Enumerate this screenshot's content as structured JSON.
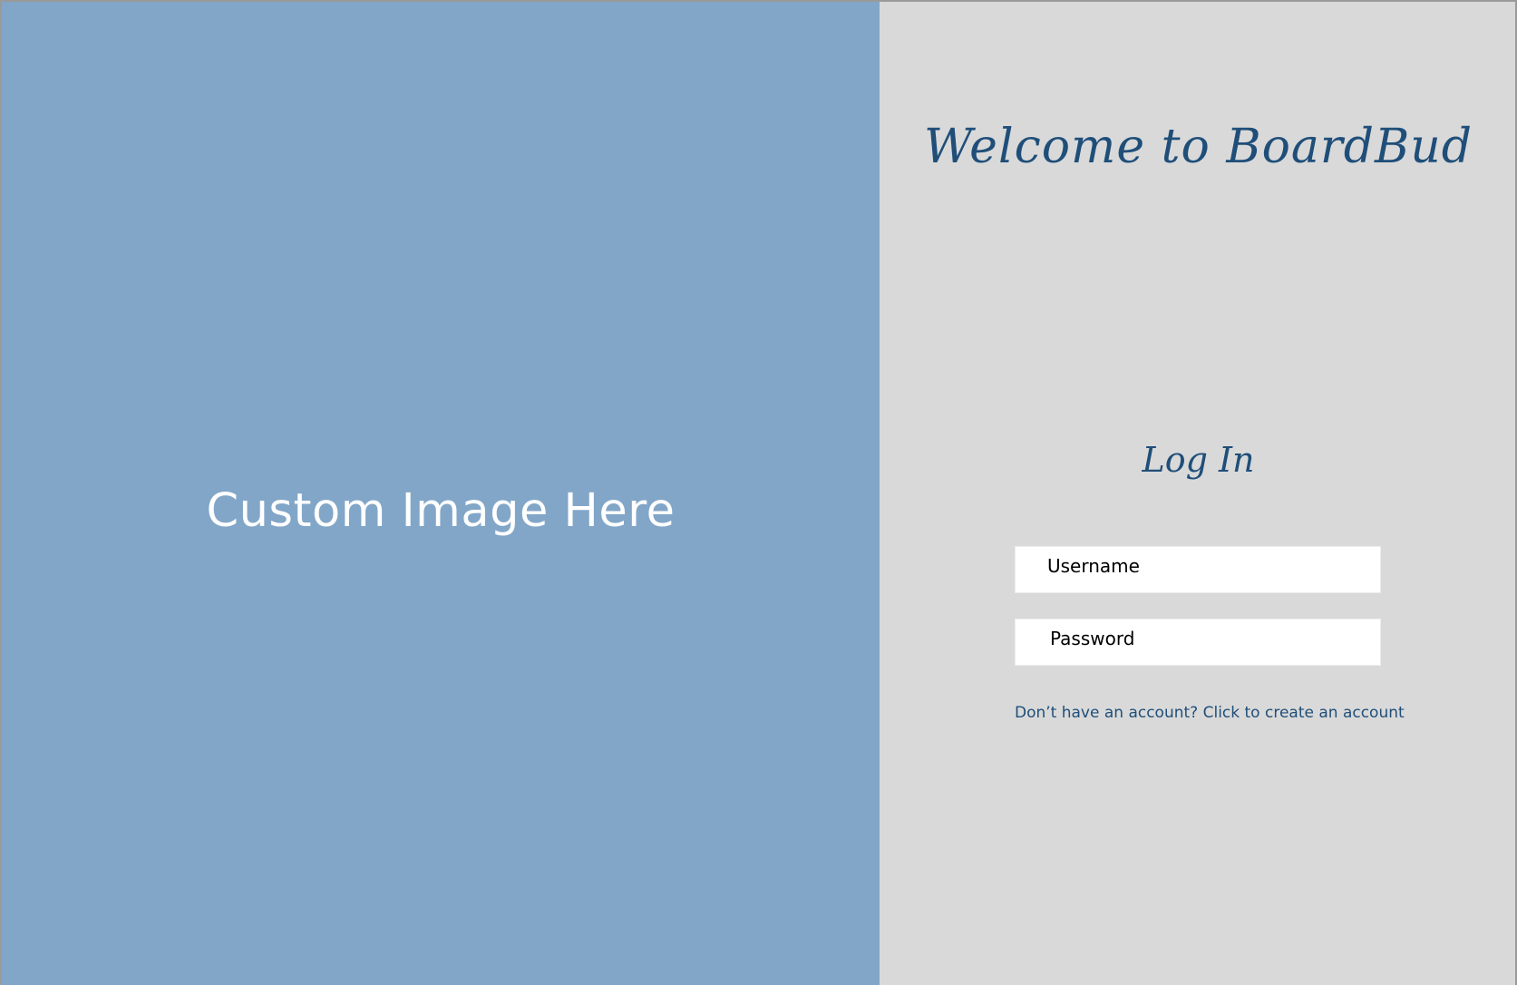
{
  "image_panel": {
    "placeholder_text": "Custom Image Here"
  },
  "login_panel": {
    "welcome_title": "Welcome to BoardBud",
    "heading": "Log In",
    "username_placeholder": "Username",
    "password_placeholder": "Password",
    "create_account_link": "Don’t have an account? Click to create an account"
  },
  "colors": {
    "image_panel_bg": "#82a6c8",
    "login_panel_bg": "#d9d9d9",
    "accent_text": "#1f4e79"
  }
}
